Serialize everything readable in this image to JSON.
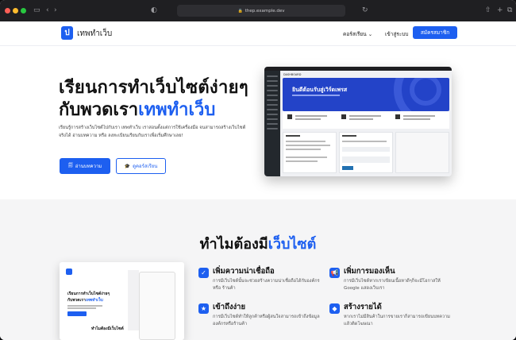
{
  "browser": {
    "url": "thep.example.dev",
    "lock_glyph": "🔒"
  },
  "header": {
    "logo_glyph": "ป",
    "logo_text": "เทพทำเว็บ",
    "nav_courses": "คอร์สเรียน ⌄",
    "nav_login": "เข้าสู่ระบบ",
    "nav_signup": "สมัครสมาชิก"
  },
  "hero": {
    "title_line1": "เรียนการทำเว็บไซต์ง่ายๆ",
    "title_line2_prefix": "กับพวดเรา",
    "title_line2_accent": "เทพทำเว็บ",
    "description": "เรียนรู้การสร้างเว็บไซต์ไปกับเรา เทพทำเว็บ เราสอนตั้งแต่การใช้เครื่องมือ จนสามารถสร้างเว็บไซต์จริงได้ อ่านบทความ หรือ ลงทะเบียนเรียนกับเราเพื่อเริ่มศึกษาเลย!",
    "btn_read_icon": "🗐",
    "btn_read": "อ่านบทความ",
    "btn_course_icon": "🎓",
    "btn_course": "ดูคอร์สเรียน"
  },
  "dashboard": {
    "title": "DASHBOARD",
    "banner_title": "ยินดีต้อนรับสู่เวิร์ดเพรส"
  },
  "why": {
    "title_prefix": "ทำไมต้องมี",
    "title_accent": "เว็บไซต์",
    "mini_title1": "เรียนการทำเว็บไซต์ง่ายๆ",
    "mini_title2_prefix": "กับพวดเรา",
    "mini_title2_accent": "เทพทำเว็บ",
    "mini_sub": "ทำไมต้องมีเว็บไซต์",
    "features": [
      {
        "icon": "✓",
        "title": "เพิ่มความน่าเชื่อถือ",
        "desc": "การมีเว็บไซต์นั้นจะช่วยสร้างความน่าเชื่อถือได้กับองค์กร หรือ ร้านค้า"
      },
      {
        "icon": "📢",
        "title": "เพิ่มการมองเห็น",
        "desc": "การมีเว็บไซต์หากเราเขียนเนื้อหาดีๆก็จะมีโอกาสให้ Google แสดงเว็บเรา"
      },
      {
        "icon": "★",
        "title": "เข้าถึงง่าย",
        "desc": "การมีเว็บไซต์ทำให้ลูกค้าหรือผู้สนใจสามารถเข้าถึงข้อมูลองค์กรหรือร้านค้า"
      },
      {
        "icon": "◆",
        "title": "สร้างรายได้",
        "desc": "หากเราไม่มีสินค้าในการขายเราก็สามารถเขียนบทความแล้วติดโฆษณา"
      }
    ]
  },
  "colors": {
    "accent": "#1d5ff0"
  }
}
